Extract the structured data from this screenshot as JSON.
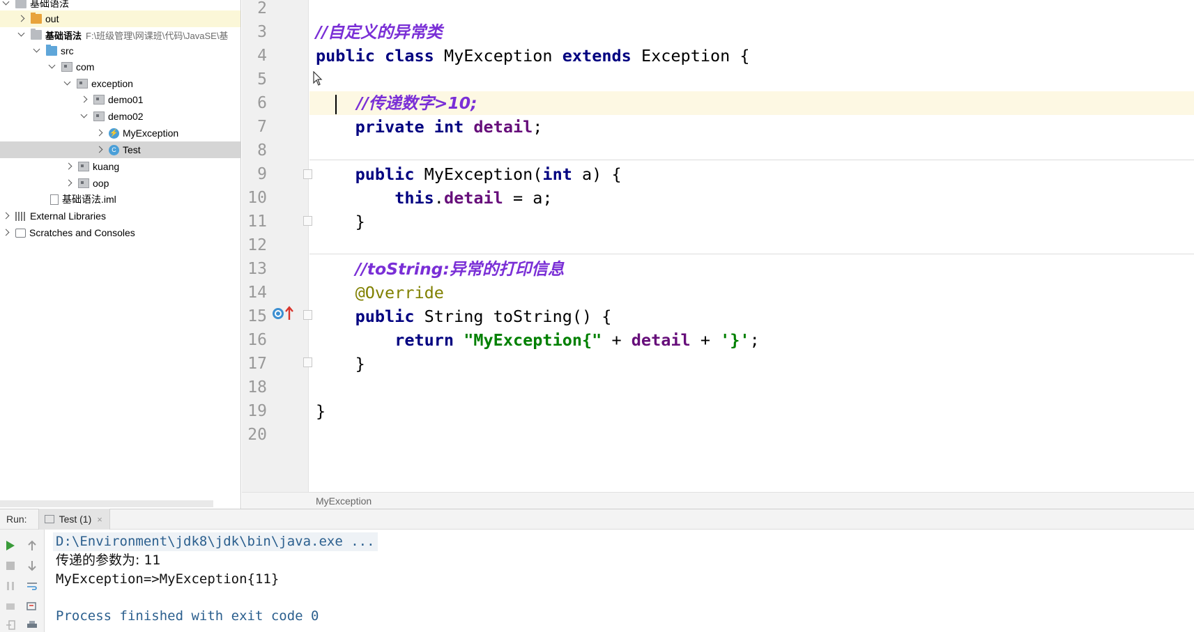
{
  "project_tree": {
    "items": [
      {
        "label": "基础语法",
        "indent": 0,
        "expanded": true,
        "icon": "module-icon"
      },
      {
        "label": "out",
        "indent": 1,
        "expanded": false,
        "icon": "folder-orange-icon"
      },
      {
        "label": "基础语法",
        "indent": 1,
        "expanded": true,
        "icon": "module-icon",
        "path": "F:\\班级管理\\网课班\\代码\\JavaSE\\基"
      },
      {
        "label": "src",
        "indent": 2,
        "expanded": true,
        "icon": "source-folder-icon"
      },
      {
        "label": "com",
        "indent": 3,
        "expanded": true,
        "icon": "package-icon"
      },
      {
        "label": "exception",
        "indent": 4,
        "expanded": true,
        "icon": "package-icon"
      },
      {
        "label": "demo01",
        "indent": 5,
        "expanded": false,
        "icon": "package-icon"
      },
      {
        "label": "demo02",
        "indent": 5,
        "expanded": true,
        "icon": "package-icon"
      },
      {
        "label": "MyException",
        "indent": 6,
        "expanded": false,
        "icon": "exception-class-icon"
      },
      {
        "label": "Test",
        "indent": 6,
        "expanded": false,
        "icon": "class-icon"
      },
      {
        "label": "kuang",
        "indent": 4,
        "expanded": false,
        "icon": "package-icon"
      },
      {
        "label": "oop",
        "indent": 4,
        "expanded": false,
        "icon": "package-icon"
      },
      {
        "label": "基础语法.iml",
        "indent": 3,
        "icon": "iml-file-icon"
      },
      {
        "label": "External Libraries",
        "indent": 0,
        "expanded": false,
        "icon": "library-icon"
      },
      {
        "label": "Scratches and Consoles",
        "indent": 0,
        "expanded": false,
        "icon": "scratch-icon"
      }
    ]
  },
  "editor": {
    "line_numbers": [
      "2",
      "3",
      "4",
      "5",
      "6",
      "7",
      "8",
      "9",
      "10",
      "11",
      "12",
      "13",
      "14",
      "15",
      "16",
      "17",
      "18",
      "19",
      "20"
    ],
    "code": {
      "l3_comment": "//自定义的异常类",
      "l4_public": "public",
      "l4_class": "class",
      "l4_name": "MyException",
      "l4_extends": "extends",
      "l4_super": "Exception {",
      "l6_comment": "//传递数字>10;",
      "l7_private": "private",
      "l7_int": "int",
      "l7_field": "detail",
      "l7_semi": ";",
      "l9_public": "public",
      "l9_ctor": "MyException(",
      "l9_int": "int",
      "l9_rest": "a) {",
      "l10_this": "this",
      "l10_dot": ".",
      "l10_field": "detail",
      "l10_rest": "= a;",
      "l11_brace": "}",
      "l13_comment": "//toString:异常的打印信息",
      "l14_annotation": "@Override",
      "l15_public": "public",
      "l15_rest": "String toString() {",
      "l16_return": "return",
      "l16_str1": "\"MyException{\"",
      "l16_plus1": "+",
      "l16_field": "detail",
      "l16_plus2": "+",
      "l16_char": "'}'",
      "l16_semi": ";",
      "l17_brace": "}",
      "l19_brace": "}"
    },
    "breadcrumb": "MyException"
  },
  "run_panel": {
    "label": "Run:",
    "tab": "Test (1)",
    "tab_close": "×",
    "console": [
      "D:\\Environment\\jdk8\\jdk\\bin\\java.exe ...",
      "传递的参数为: 11",
      "MyException=>MyException{11}",
      "",
      "Process finished with exit code 0"
    ]
  },
  "colors": {
    "keyword": "#000080",
    "field": "#660e7a",
    "comment": "#7a2fd6",
    "annotation": "#808000",
    "string": "#008000",
    "current_line": "#fdf8e3"
  }
}
